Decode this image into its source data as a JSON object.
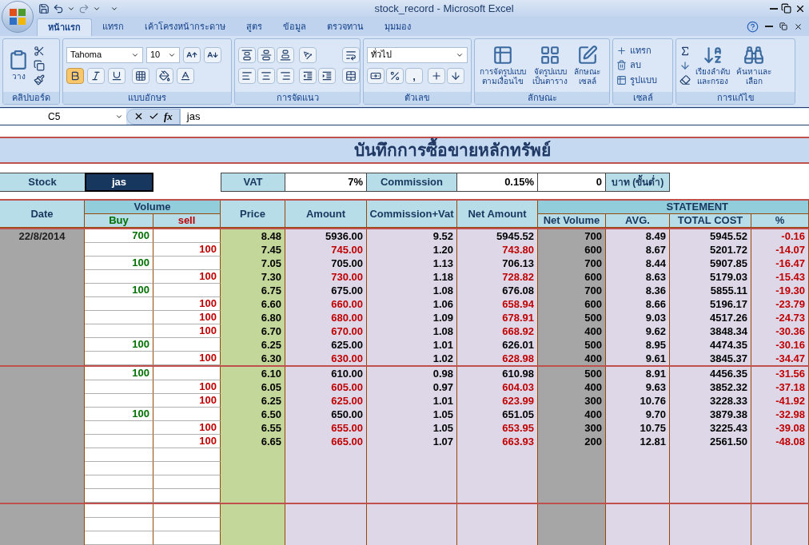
{
  "window": {
    "title": "stock_record - Microsoft Excel"
  },
  "tabs": [
    {
      "label": "หน้าแรก",
      "selected": true
    },
    {
      "label": "แทรก",
      "selected": false
    },
    {
      "label": "เค้าโครงหน้ากระดาษ",
      "selected": false
    },
    {
      "label": "สูตร",
      "selected": false
    },
    {
      "label": "ข้อมูล",
      "selected": false
    },
    {
      "label": "ตรวจทาน",
      "selected": false
    },
    {
      "label": "มุมมอง",
      "selected": false
    }
  ],
  "ribbon": {
    "clipboard": {
      "label": "คลิปบอร์ด",
      "paste": "วาง"
    },
    "font": {
      "label": "แบบอักษร",
      "name": "Tahoma",
      "size": "10",
      "bold_on": true
    },
    "alignment": {
      "label": "การจัดแนว"
    },
    "number": {
      "label": "ตัวเลข",
      "format": "ทั่วไป",
      "comma": ","
    },
    "styles": {
      "label": "ลักษณะ",
      "buttons": [
        "การจัดรูปแบบ\nตามเงื่อนไข",
        "จัดรูปแบบ\nเป็นตาราง",
        "ลักษณะ\nเซลล์"
      ]
    },
    "cells": {
      "label": "เซลล์",
      "buttons": [
        "แทรก",
        "ลบ",
        "รูปแบบ"
      ]
    },
    "editing": {
      "label": "การแก้ไข",
      "buttons": [
        "เรียงลำดับ\nและกรอง",
        "ค้นหาและ\nเลือก"
      ]
    }
  },
  "formula_bar": {
    "name_box": "C5",
    "fx": "fx",
    "value": "jas"
  },
  "sheet": {
    "title": "บันทึกการซื้อขายหลักทรัพย์",
    "settings": {
      "stock_label": "Stock",
      "stock": "jas",
      "vat_label": "VAT",
      "vat": "7%",
      "commission_label": "Commission",
      "commission": "0.15%",
      "minimum": "0",
      "minimum_unit": "บาท (ขั้นต่ำ)"
    },
    "headers": {
      "date": "Date",
      "volume": "Volume",
      "buy": "Buy",
      "sell": "sell",
      "price": "Price",
      "amount": "Amount",
      "fee": "Commission+Vat",
      "net": "Net Amount",
      "statement": "STATEMENT",
      "net_volume": "Net Volume",
      "avg": "AVG.",
      "total_cost": "TOTAL COST",
      "pct": "%"
    },
    "groups": [
      {
        "date": "22/8/2014",
        "rows": [
          {
            "kind": "buy",
            "volume": "700",
            "price": "8.48",
            "amount": "5936.00",
            "fee": "9.52",
            "net": "5945.52",
            "net_volume": "700",
            "avg": "8.49",
            "total_cost": "5945.52",
            "pct": "-0.16"
          },
          {
            "kind": "sell",
            "volume": "100",
            "price": "7.45",
            "amount": "745.00",
            "fee": "1.20",
            "net": "743.80",
            "net_volume": "600",
            "avg": "8.67",
            "total_cost": "5201.72",
            "pct": "-14.07"
          },
          {
            "kind": "buy",
            "volume": "100",
            "price": "7.05",
            "amount": "705.00",
            "fee": "1.13",
            "net": "706.13",
            "net_volume": "700",
            "avg": "8.44",
            "total_cost": "5907.85",
            "pct": "-16.47"
          },
          {
            "kind": "sell",
            "volume": "100",
            "price": "7.30",
            "amount": "730.00",
            "fee": "1.18",
            "net": "728.82",
            "net_volume": "600",
            "avg": "8.63",
            "total_cost": "5179.03",
            "pct": "-15.43"
          },
          {
            "kind": "buy",
            "volume": "100",
            "price": "6.75",
            "amount": "675.00",
            "fee": "1.08",
            "net": "676.08",
            "net_volume": "700",
            "avg": "8.36",
            "total_cost": "5855.11",
            "pct": "-19.30"
          },
          {
            "kind": "sell",
            "volume": "100",
            "price": "6.60",
            "amount": "660.00",
            "fee": "1.06",
            "net": "658.94",
            "net_volume": "600",
            "avg": "8.66",
            "total_cost": "5196.17",
            "pct": "-23.79"
          },
          {
            "kind": "sell",
            "volume": "100",
            "price": "6.80",
            "amount": "680.00",
            "fee": "1.09",
            "net": "678.91",
            "net_volume": "500",
            "avg": "9.03",
            "total_cost": "4517.26",
            "pct": "-24.73"
          },
          {
            "kind": "sell",
            "volume": "100",
            "price": "6.70",
            "amount": "670.00",
            "fee": "1.08",
            "net": "668.92",
            "net_volume": "400",
            "avg": "9.62",
            "total_cost": "3848.34",
            "pct": "-30.36"
          },
          {
            "kind": "buy",
            "volume": "100",
            "price": "6.25",
            "amount": "625.00",
            "fee": "1.01",
            "net": "626.01",
            "net_volume": "500",
            "avg": "8.95",
            "total_cost": "4474.35",
            "pct": "-30.16"
          },
          {
            "kind": "sell",
            "volume": "100",
            "price": "6.30",
            "amount": "630.00",
            "fee": "1.02",
            "net": "628.98",
            "net_volume": "400",
            "avg": "9.61",
            "total_cost": "3845.37",
            "pct": "-34.47"
          }
        ]
      },
      {
        "rows": [
          {
            "kind": "buy",
            "volume": "100",
            "price": "6.10",
            "amount": "610.00",
            "fee": "0.98",
            "net": "610.98",
            "net_volume": "500",
            "avg": "8.91",
            "total_cost": "4456.35",
            "pct": "-31.56"
          },
          {
            "kind": "sell",
            "volume": "100",
            "price": "6.05",
            "amount": "605.00",
            "fee": "0.97",
            "net": "604.03",
            "net_volume": "400",
            "avg": "9.63",
            "total_cost": "3852.32",
            "pct": "-37.18"
          },
          {
            "kind": "sell",
            "volume": "100",
            "price": "6.25",
            "amount": "625.00",
            "fee": "1.01",
            "net": "623.99",
            "net_volume": "300",
            "avg": "10.76",
            "total_cost": "3228.33",
            "pct": "-41.92"
          },
          {
            "kind": "buy",
            "volume": "100",
            "price": "6.50",
            "amount": "650.00",
            "fee": "1.05",
            "net": "651.05",
            "net_volume": "400",
            "avg": "9.70",
            "total_cost": "3879.38",
            "pct": "-32.98"
          },
          {
            "kind": "sell",
            "volume": "100",
            "price": "6.55",
            "amount": "655.00",
            "fee": "1.05",
            "net": "653.95",
            "net_volume": "300",
            "avg": "10.75",
            "total_cost": "3225.43",
            "pct": "-39.08"
          },
          {
            "kind": "sell",
            "volume": "100",
            "price": "6.65",
            "amount": "665.00",
            "fee": "1.07",
            "net": "663.93",
            "net_volume": "200",
            "avg": "12.81",
            "total_cost": "2561.50",
            "pct": "-48.08"
          },
          {
            "kind": "blank"
          },
          {
            "kind": "blank"
          },
          {
            "kind": "blank"
          },
          {
            "kind": "blank"
          }
        ]
      },
      {
        "rows": [
          {
            "kind": "blank"
          },
          {
            "kind": "blank"
          },
          {
            "kind": "blank"
          }
        ]
      }
    ]
  }
}
